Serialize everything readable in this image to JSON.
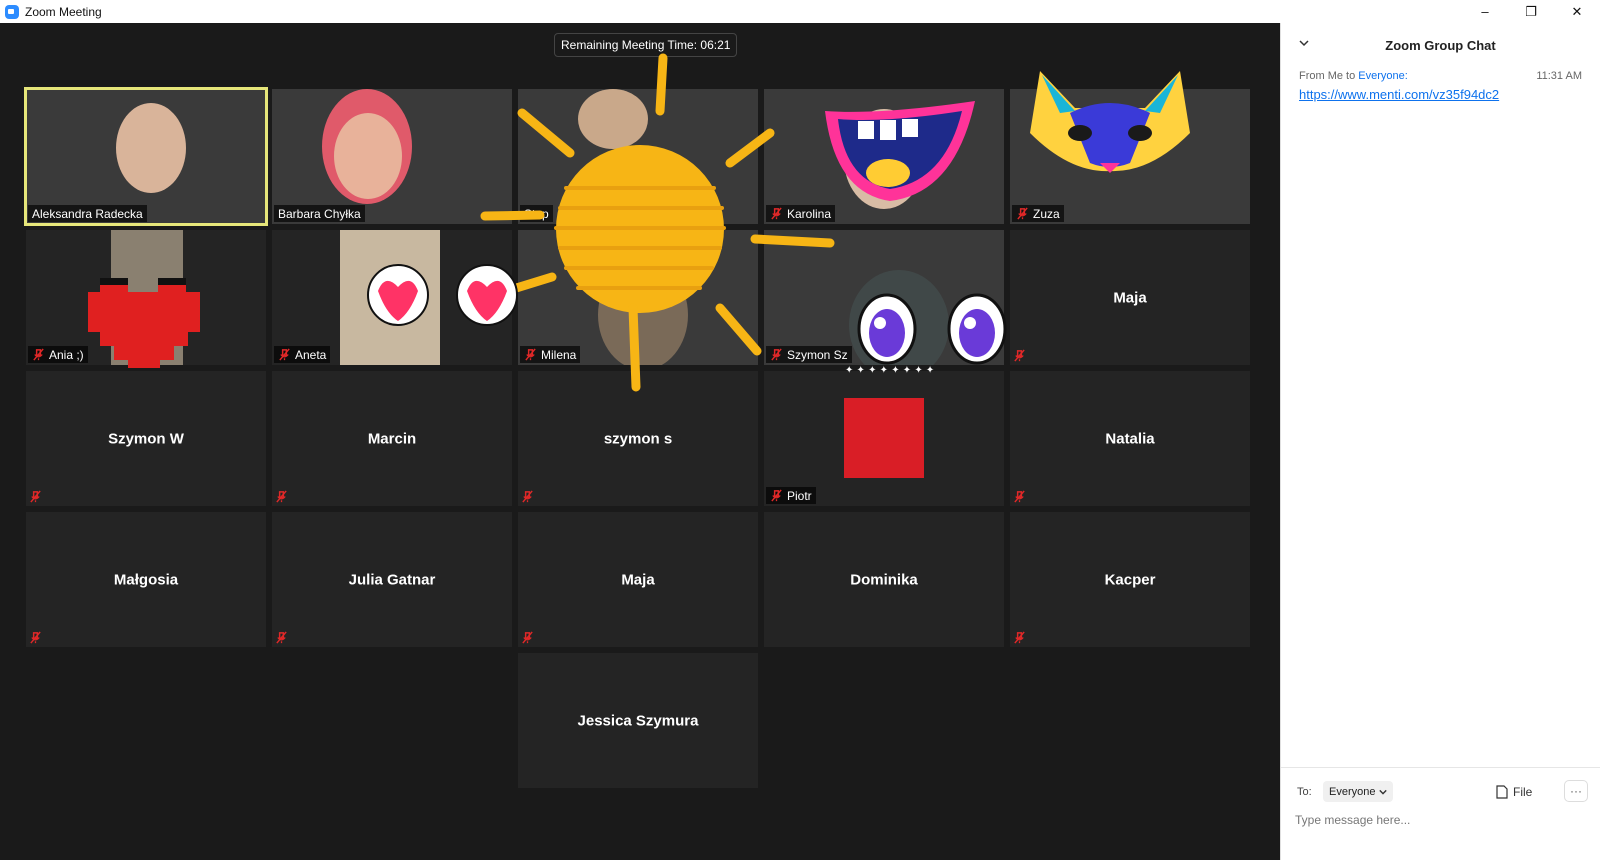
{
  "window": {
    "title": "Zoom Meeting",
    "controls": {
      "minimize": "–",
      "restore": "❐",
      "close": "✕"
    }
  },
  "meeting": {
    "timer": "Remaining Meeting Time: 06:21",
    "participants": [
      {
        "name": "Aleksandra Radecka",
        "video": true,
        "muted": false,
        "active": true
      },
      {
        "name": "Barbara Chyłka",
        "video": true,
        "muted": false
      },
      {
        "name": "Stop",
        "video": true,
        "muted": false
      },
      {
        "name": "Karolina",
        "video": true,
        "muted": true
      },
      {
        "name": "Zuza",
        "video": true,
        "muted": true
      },
      {
        "name": "Ania ;)",
        "video": true,
        "muted": true
      },
      {
        "name": "Aneta",
        "video": true,
        "muted": true
      },
      {
        "name": "Milena",
        "video": true,
        "muted": true
      },
      {
        "name": "Szymon Sz",
        "video": true,
        "muted": true
      },
      {
        "name": "Maja",
        "video": false,
        "muted": true
      },
      {
        "name": "Szymon W",
        "video": false,
        "muted": true
      },
      {
        "name": "Marcin",
        "video": false,
        "muted": true
      },
      {
        "name": "szymon s",
        "video": false,
        "muted": true
      },
      {
        "name": "Piotr",
        "video": true,
        "muted": true
      },
      {
        "name": "Natalia",
        "video": false,
        "muted": true
      },
      {
        "name": "Małgosia",
        "video": false,
        "muted": true
      },
      {
        "name": "Julia Gatnar",
        "video": false,
        "muted": true
      },
      {
        "name": "Maja",
        "video": false,
        "muted": true
      },
      {
        "name": "Dominika",
        "video": false,
        "muted": false
      },
      {
        "name": "Kacper",
        "video": false,
        "muted": true
      },
      {
        "name": "Jessica Szymura",
        "video": false,
        "muted": false
      }
    ]
  },
  "chat": {
    "title": "Zoom Group Chat",
    "message": {
      "from": "From Me to",
      "to": "Everyone:",
      "time": "11:31 AM",
      "text": "https://www.menti.com/vz35f94dc2"
    },
    "footer": {
      "to_label": "To:",
      "recipient": "Everyone",
      "file_label": "File",
      "more_label": "···",
      "placeholder": "Type message here..."
    }
  },
  "colors": {
    "accent": "#0e72ed",
    "active_speaker": "#e6e67a",
    "mute_red": "#e02828",
    "annotation_yellow": "#f7b515",
    "piotr_avatar": "#d91e26"
  }
}
